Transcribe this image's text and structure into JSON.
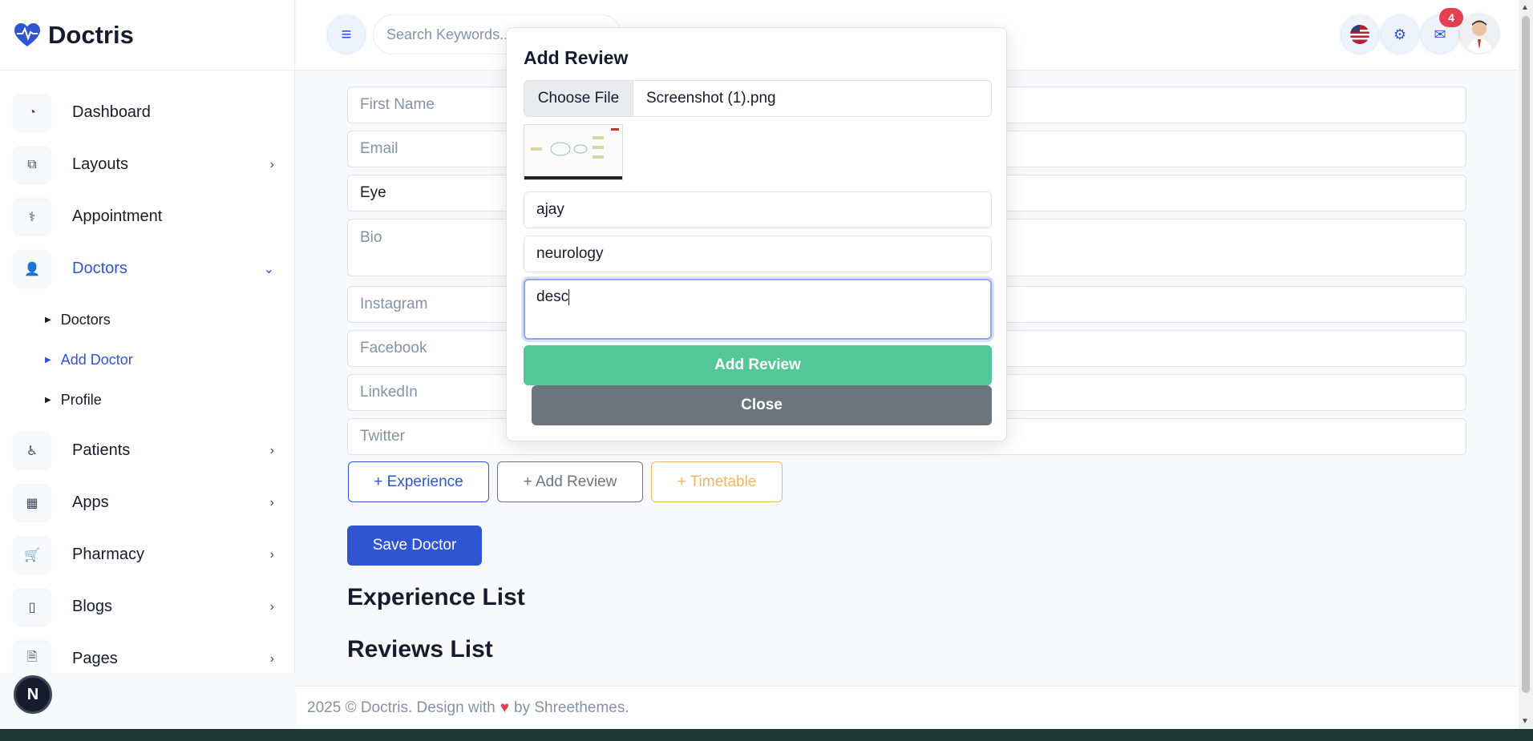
{
  "brand": {
    "name": "Doctris"
  },
  "sidebar": {
    "items": [
      {
        "label": "Dashboard",
        "icon": "dashboard-icon"
      },
      {
        "label": "Layouts",
        "icon": "layouts-icon"
      },
      {
        "label": "Appointment",
        "icon": "stethoscope-icon"
      },
      {
        "label": "Doctors",
        "icon": "user-icon"
      },
      {
        "label": "Patients",
        "icon": "wheelchair-icon"
      },
      {
        "label": "Apps",
        "icon": "apps-icon"
      },
      {
        "label": "Pharmacy",
        "icon": "cart-icon"
      },
      {
        "label": "Blogs",
        "icon": "blog-icon"
      },
      {
        "label": "Pages",
        "icon": "page-icon"
      }
    ],
    "doctors_sub": [
      "Doctors",
      "Add Doctor",
      "Profile"
    ],
    "bottom_badge": "N"
  },
  "topbar": {
    "search_placeholder": "Search Keywords...",
    "notification_count": "4"
  },
  "form": {
    "first_name_placeholder": "First Name",
    "email_placeholder": "Email",
    "department_value": "Eye",
    "bio_placeholder": "Bio",
    "instagram_placeholder": "Instagram",
    "facebook_placeholder": "Facebook",
    "linkedin_placeholder": "LinkedIn",
    "twitter_placeholder": "Twitter",
    "experience_btn": "+ Experience",
    "add_review_btn": "+ Add Review",
    "timetable_btn": "+ Timetable",
    "save_btn": "Save Doctor",
    "experience_list_title": "Experience List",
    "reviews_list_title": "Reviews List"
  },
  "modal": {
    "title": "Add Review",
    "choose_file": "Choose File",
    "file_name": "Screenshot (1).png",
    "name_value": "ajay",
    "specialty_value": "neurology",
    "description_value": "desc",
    "add_btn": "Add Review",
    "close_btn": "Close"
  },
  "footer": {
    "prefix": "2025 © Doctris. Design with",
    "suffix": "by Shreethemes."
  },
  "colors": {
    "primary": "#2f55d4",
    "success": "#53c797",
    "secondary": "#6c757d",
    "warning": "#f1b561",
    "danger": "#e43f52"
  }
}
